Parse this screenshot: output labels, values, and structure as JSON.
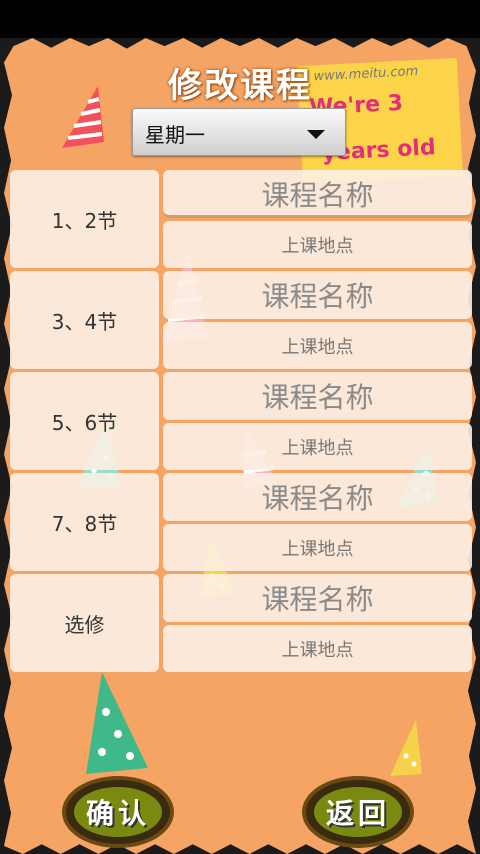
{
  "app": {
    "title": "修改课程",
    "watermark": "www.meitu.com",
    "banner_line1": "We're 3",
    "banner_line2": "years old"
  },
  "day_select": {
    "selected": "星期一"
  },
  "periods": [
    {
      "label": "1、2节",
      "name_placeholder": "课程名称",
      "location_placeholder": "上课地点"
    },
    {
      "label": "3、4节",
      "name_placeholder": "课程名称",
      "location_placeholder": "上课地点"
    },
    {
      "label": "5、6节",
      "name_placeholder": "课程名称",
      "location_placeholder": "上课地点"
    },
    {
      "label": "7、8节",
      "name_placeholder": "课程名称",
      "location_placeholder": "上课地点"
    },
    {
      "label": "选修",
      "name_placeholder": "课程名称",
      "location_placeholder": "上课地点"
    }
  ],
  "buttons": {
    "confirm": "确认",
    "back": "返回"
  },
  "colors": {
    "background": "#f6a464",
    "card": "#fdf0e4",
    "button_fill": "#7a8a10"
  }
}
